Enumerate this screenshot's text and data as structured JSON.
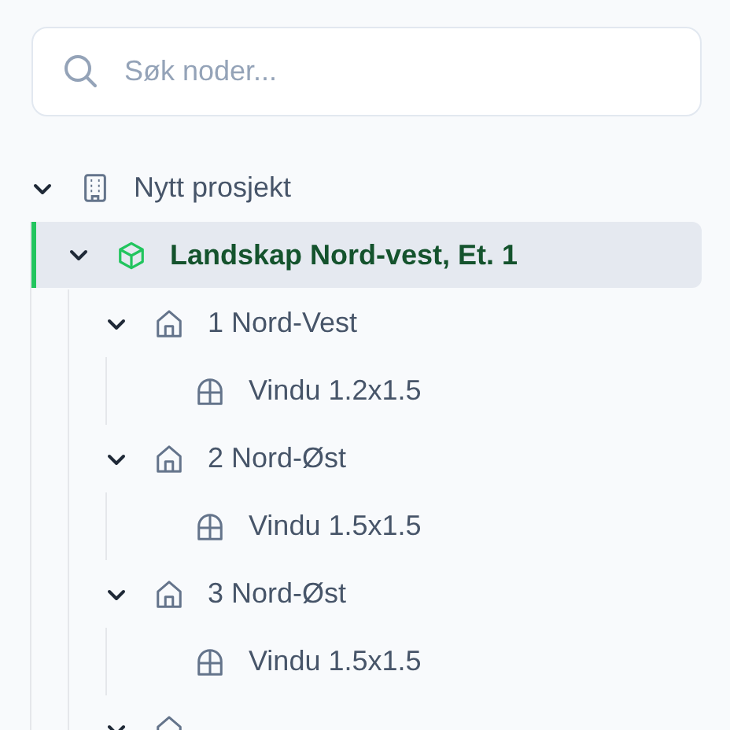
{
  "search": {
    "placeholder": "Søk noder..."
  },
  "tree": [
    {
      "kind": "project",
      "label": "Nytt prosjekt",
      "expanded": true,
      "selected": false,
      "children": [
        {
          "kind": "landscape",
          "label": "Landskap Nord-vest, Et. 1",
          "expanded": true,
          "selected": true,
          "children": [
            {
              "kind": "room",
              "label": "1 Nord-Vest",
              "expanded": true,
              "selected": false,
              "children": [
                {
                  "kind": "window",
                  "label": "Vindu 1.2x1.5",
                  "selected": false
                }
              ]
            },
            {
              "kind": "room",
              "label": "2 Nord-Øst",
              "expanded": true,
              "selected": false,
              "children": [
                {
                  "kind": "window",
                  "label": "Vindu 1.5x1.5",
                  "selected": false
                }
              ]
            },
            {
              "kind": "room",
              "label": "3 Nord-Øst",
              "expanded": true,
              "selected": false,
              "children": [
                {
                  "kind": "window",
                  "label": "Vindu 1.5x1.5",
                  "selected": false
                }
              ]
            },
            {
              "kind": "room",
              "expanded": true,
              "selected": false
            }
          ]
        }
      ]
    }
  ]
}
